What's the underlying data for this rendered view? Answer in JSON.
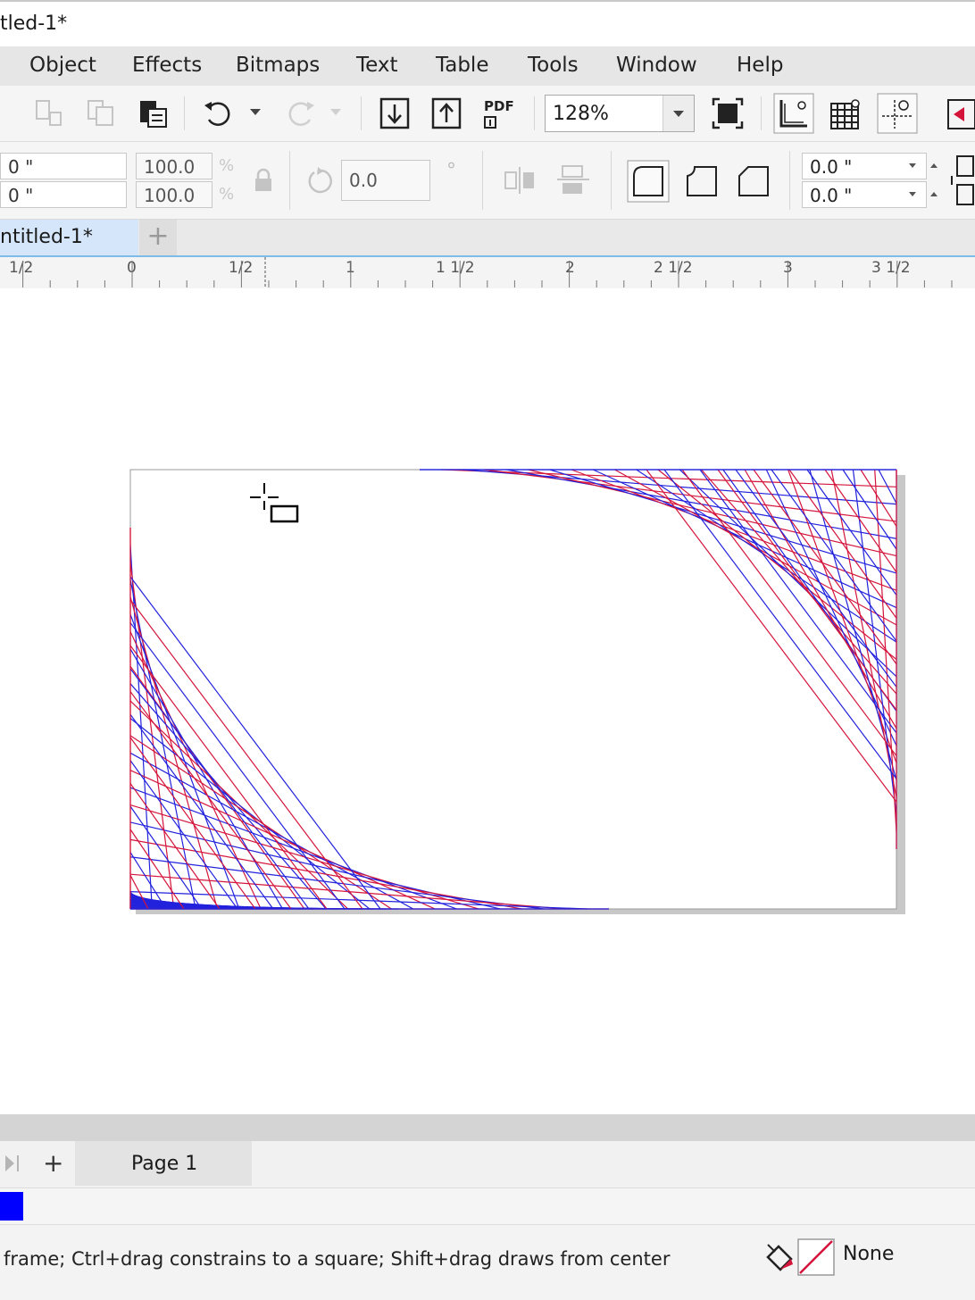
{
  "window": {
    "title": "tled-1*"
  },
  "menu": {
    "items": [
      "Object",
      "Effects",
      "Bitmaps",
      "Text",
      "Table",
      "Tools",
      "Window",
      "Help"
    ]
  },
  "toolbar": {
    "zoom_value": "128%",
    "pdf_label": "PDF",
    "icons": [
      "copy-icon",
      "copy-properties-icon",
      "paste-icon",
      "undo-icon",
      "undo-dropdown-icon",
      "redo-icon",
      "redo-dropdown-icon",
      "import-icon",
      "export-icon",
      "publish-pdf-icon",
      "full-screen-icon",
      "rulers-icon",
      "grid-icon",
      "guidelines-icon",
      "options-icon"
    ]
  },
  "propbar": {
    "x_value": "0 \"",
    "y_value": "0 \"",
    "scale_w": "100.0",
    "scale_h": "100.0",
    "pct": "%",
    "rotation": "0.0",
    "degree_symbol": "°",
    "corner_a": "0.0 \"",
    "corner_b": "0.0 \""
  },
  "document": {
    "tab_label": "ntitled-1*",
    "add_tab": "+"
  },
  "ruler": {
    "labels": [
      "1/2",
      "0",
      "1/2",
      "1",
      "1 1/2",
      "2",
      "2 1/2",
      "3",
      "3 1/2"
    ]
  },
  "pages": {
    "add": "+",
    "current_page": "Page 1"
  },
  "palette": {
    "swatch_color": "#0000ff"
  },
  "status": {
    "message": "frame; Ctrl+drag constrains to a square; Shift+drag draws from center",
    "fill_label": "None"
  },
  "colors": {
    "line_red": "#d4143a",
    "line_blue": "#2222dd",
    "accent": "#7fbbe9"
  }
}
